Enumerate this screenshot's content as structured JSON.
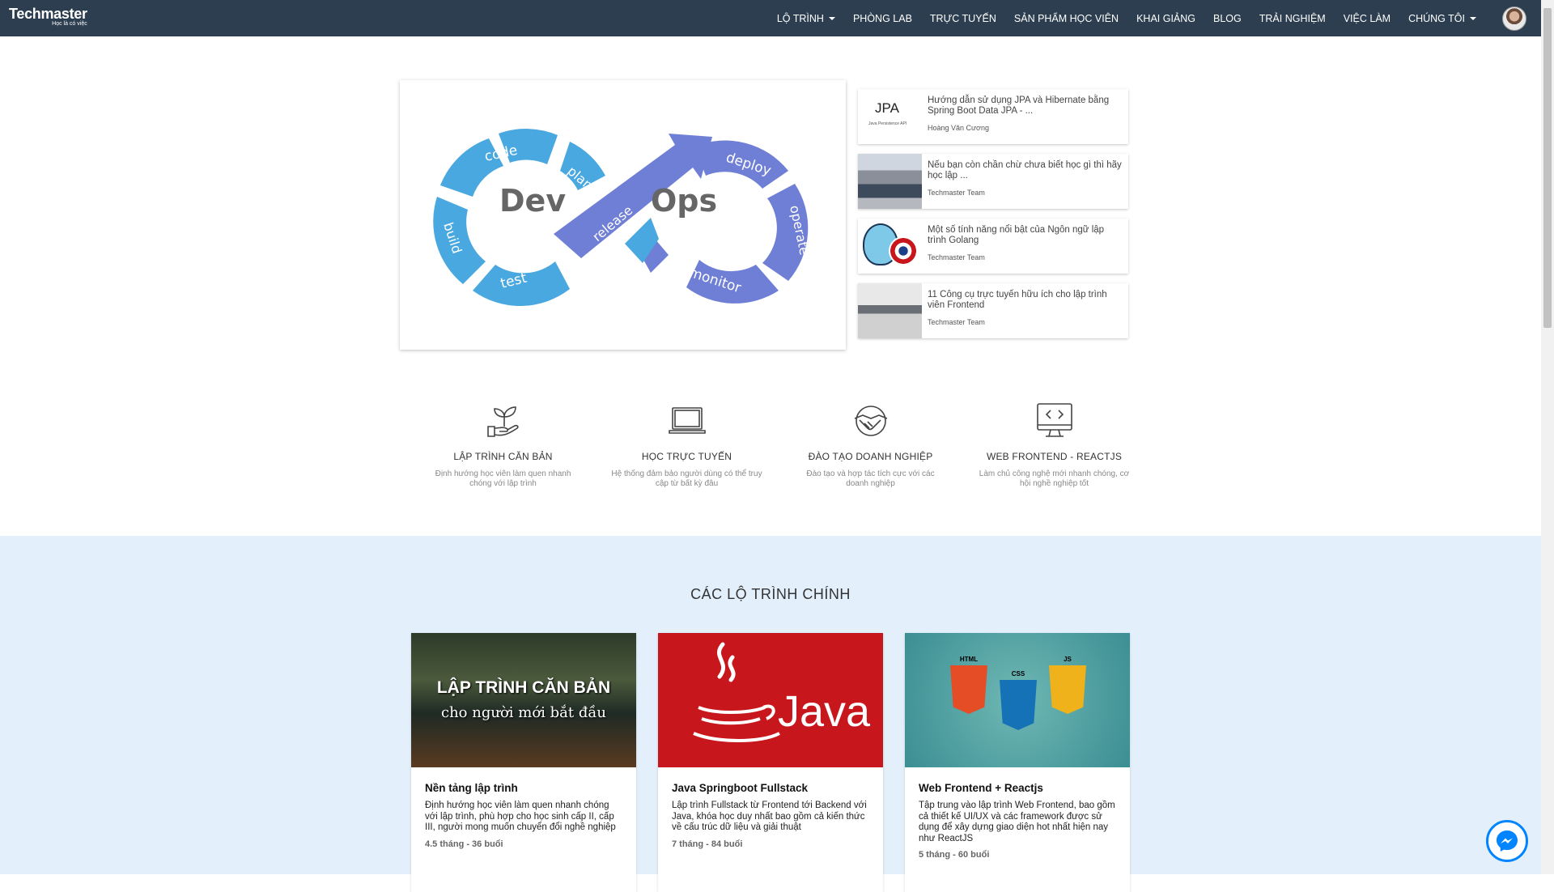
{
  "brand": {
    "name": "Techmaster",
    "tagline": "Học là có việc"
  },
  "nav": {
    "items": [
      {
        "label": "LỘ TRÌNH",
        "dropdown": true
      },
      {
        "label": "PHÒNG LAB",
        "dropdown": false
      },
      {
        "label": "TRỰC TUYẾN",
        "dropdown": false
      },
      {
        "label": "SẢN PHẨM HỌC VIÊN",
        "dropdown": false
      },
      {
        "label": "KHAI GIẢNG",
        "dropdown": false
      },
      {
        "label": "BLOG",
        "dropdown": false
      },
      {
        "label": "TRẢI NGHIỆM",
        "dropdown": false
      },
      {
        "label": "VIỆC LÀM",
        "dropdown": false
      },
      {
        "label": "CHÚNG TÔI",
        "dropdown": true
      }
    ]
  },
  "hero": {
    "devops": {
      "left": "Dev",
      "right": "Ops",
      "steps": [
        "code",
        "plan",
        "build",
        "test",
        "release",
        "deploy",
        "operate",
        "monitor"
      ]
    }
  },
  "posts": [
    {
      "title": "Hướng dẫn sử dụng JPA và Hibernate bằng Spring Boot Data JPA - ...",
      "author": "Hoàng Văn Cương",
      "thumb_text": "JPA",
      "thumb_sub": "Java Persistence API"
    },
    {
      "title": "Nếu bạn còn chần chừ chưa biết học gì thì hãy học lập ...",
      "author": "Techmaster Team"
    },
    {
      "title": "Một số tính năng nổi bật của Ngôn ngữ lập trình Golang",
      "author": "Techmaster Team"
    },
    {
      "title": "11 Công cụ trực tuyến hữu ích cho lập trình viên Frontend",
      "author": "Techmaster Team"
    }
  ],
  "features": [
    {
      "title": "LẬP TRÌNH CĂN BẢN",
      "desc": "Định hướng học viên làm quen nhanh chóng với lập trình",
      "icon": "plant-hand-icon"
    },
    {
      "title": "HỌC TRỰC TUYẾN",
      "desc": "Hệ thống đảm bảo người dùng có thể truy cập từ bất kỳ đâu",
      "icon": "laptop-icon"
    },
    {
      "title": "ĐÀO TẠO DOANH NGHIỆP",
      "desc": "Đào tạo và hợp tác tích cực với các doanh nghiệp",
      "icon": "handshake-icon"
    },
    {
      "title": "WEB FRONTEND - REACTJS",
      "desc": "Làm chủ công nghệ mới nhanh chóng, cơ hội nghề nghiệp tốt",
      "icon": "code-monitor-icon"
    }
  ],
  "routes": {
    "title": "CÁC LỘ TRÌNH CHÍNH",
    "courses": [
      {
        "name": "Nền tảng lập trình",
        "desc": "Định hướng học viên làm quen nhanh chóng với lập trình, phù hợp cho học sinh cấp II, cấp III, người mong muốn chuyển đổi nghề nghiệp",
        "meta": "4.5 tháng - 36 buổi",
        "img_line1": "LẬP TRÌNH CĂN BẢN",
        "img_line2": "cho người mới bắt đầu"
      },
      {
        "name": "Java Springboot Fullstack",
        "desc": "Lập trình Fullstack từ Frontend tới Backend với Java, khóa học duy nhất bao gồm cả kiến thức về cấu trúc dữ liệu và giải thuật",
        "meta": "7 tháng - 84 buổi",
        "img_text": "Java"
      },
      {
        "name": "Web Frontend + Reactjs",
        "desc": "Tập trung vào lập trình Web Frontend, bao gồm cả thiết kế UI/UX và các framework được sử dụng để xây dựng giao diện hot nhất hiện nay như ReactJS",
        "meta": "5 tháng - 60 buổi",
        "img_badges": [
          "HTML",
          "CSS",
          "JS"
        ]
      }
    ]
  },
  "colors": {
    "navbar": "#2c3e50",
    "routes_bg": "#e3f0fb",
    "devops_blue": "#4aa8e0",
    "devops_purple": "#6f7fd6",
    "java_red": "#c8161d",
    "messenger": "#0084ff"
  }
}
